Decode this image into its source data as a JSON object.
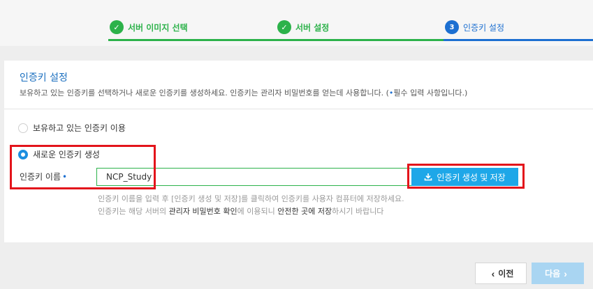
{
  "stepper": {
    "steps": [
      {
        "label": "서버 이미지 선택",
        "state": "done",
        "icon": "check-icon"
      },
      {
        "label": "서버 설정",
        "state": "done",
        "icon": "check-icon"
      },
      {
        "label": "인증키 설정",
        "state": "current",
        "number": "3"
      }
    ],
    "colors": {
      "done": "#2cb24a",
      "current": "#1c6fd1"
    }
  },
  "section": {
    "title": "인증키 설정",
    "description": "보유하고 있는 인증키를 선택하거나 새로운 인증키를 생성하세요. 인증키는 관리자 비밀번호를 얻는데 사용합니다. (",
    "required_note": "필수 입력 사항입니다.)"
  },
  "options": {
    "existing": {
      "label": "보유하고 있는 인증키 이용",
      "selected": false
    },
    "new": {
      "label": "새로운 인증키 생성",
      "selected": true
    }
  },
  "key_name": {
    "label": "인증키 이름",
    "value": "NCP_Study"
  },
  "generate_button": {
    "label": "인증키 생성 및 저장",
    "icon": "download-icon"
  },
  "hints": {
    "line1": "인증키 이름을 입력 후 [인증키 생성 및 저장]를 클릭하여 인증키를 사용자 컴퓨터에 저장하세요.",
    "line2_a": "인증키는 해당 서버의 ",
    "line2_b": "관리자 비밀번호 확인",
    "line2_c": "에 이용되니 ",
    "line2_d": "안전한 곳에 저장",
    "line2_e": "하시기 바랍니다"
  },
  "footer": {
    "prev_label": "이전",
    "next_label": "다음"
  },
  "annotation_color": "#e3141b"
}
